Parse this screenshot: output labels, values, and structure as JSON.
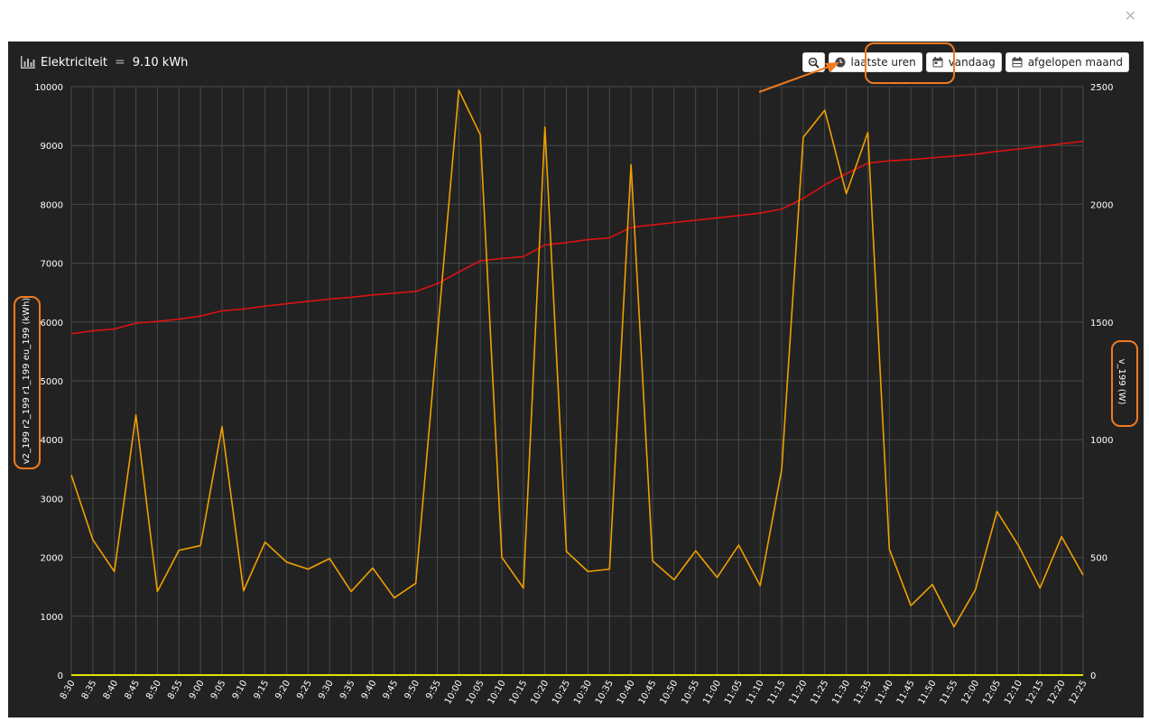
{
  "header": {
    "title": "Elektriciteit",
    "equals": "=",
    "total": "9.10 kWh"
  },
  "toolbar": {
    "latest": "laatste uren",
    "today": "vandaag",
    "month": "afgelopen maand"
  },
  "colors": {
    "counter": "#dd1111",
    "power": "#f0a000",
    "zero": "#e0e000",
    "accent": "#f07a20"
  },
  "chart_data": {
    "type": "line",
    "x": [
      "8:30",
      "8:35",
      "8:40",
      "8:45",
      "8:50",
      "8:55",
      "9:00",
      "9:05",
      "9:10",
      "9:15",
      "9:20",
      "9:25",
      "9:30",
      "9:35",
      "9:40",
      "9:45",
      "9:50",
      "9:55",
      "10:00",
      "10:05",
      "10:10",
      "10:15",
      "10:20",
      "10:25",
      "10:30",
      "10:35",
      "10:40",
      "10:45",
      "10:50",
      "10:55",
      "11:00",
      "11:05",
      "11:10",
      "11:15",
      "11:20",
      "11:25",
      "11:30",
      "11:35",
      "11:40",
      "11:45",
      "11:50",
      "11:55",
      "12:00",
      "12:05",
      "12:10",
      "12:15",
      "12:20",
      "12:25"
    ],
    "yleft": {
      "label": "v2_199 r2_199 r1_199 eu_199 (kWh)",
      "range": [
        0,
        10000
      ],
      "ticks": [
        0,
        1000,
        2000,
        3000,
        4000,
        5000,
        6000,
        7000,
        8000,
        9000,
        10000
      ]
    },
    "yright": {
      "label": "v_199 (W)",
      "range": [
        0,
        2500
      ],
      "ticks": [
        0,
        500,
        1000,
        1500,
        2000,
        2500
      ]
    },
    "series": [
      {
        "axis": "left",
        "color": "#dd1111",
        "values": [
          5800,
          5850,
          5880,
          5980,
          6010,
          6050,
          6100,
          6190,
          6220,
          6270,
          6310,
          6350,
          6390,
          6420,
          6460,
          6490,
          6520,
          6650,
          6850,
          7040,
          7080,
          7110,
          7310,
          7350,
          7400,
          7430,
          7610,
          7650,
          7690,
          7730,
          7770,
          7810,
          7850,
          7920,
          8100,
          8330,
          8520,
          8700,
          8740,
          8760,
          8790,
          8820,
          8850,
          8900,
          8940,
          8980,
          9030,
          9070
        ]
      },
      {
        "axis": "right",
        "color": "#f0a000",
        "values": [
          850,
          575,
          440,
          1105,
          355,
          530,
          550,
          1055,
          358,
          565,
          480,
          450,
          495,
          355,
          455,
          328,
          390,
          1440,
          2485,
          2295,
          500,
          370,
          2328,
          525,
          440,
          450,
          2168,
          485,
          405,
          528,
          415,
          552,
          380,
          875,
          2285,
          2400,
          2045,
          2305,
          535,
          295,
          385,
          205,
          363,
          695,
          550,
          370,
          588,
          425
        ]
      },
      {
        "axis": "left",
        "color": "#e0e000",
        "values": [
          0,
          0,
          0,
          0,
          0,
          0,
          0,
          0,
          0,
          0,
          0,
          0,
          0,
          0,
          0,
          0,
          0,
          0,
          0,
          0,
          0,
          0,
          0,
          0,
          0,
          0,
          0,
          0,
          0,
          0,
          0,
          0,
          0,
          0,
          0,
          0,
          0,
          0,
          0,
          0,
          0,
          0,
          0,
          0,
          0,
          0,
          0,
          0
        ]
      }
    ]
  }
}
